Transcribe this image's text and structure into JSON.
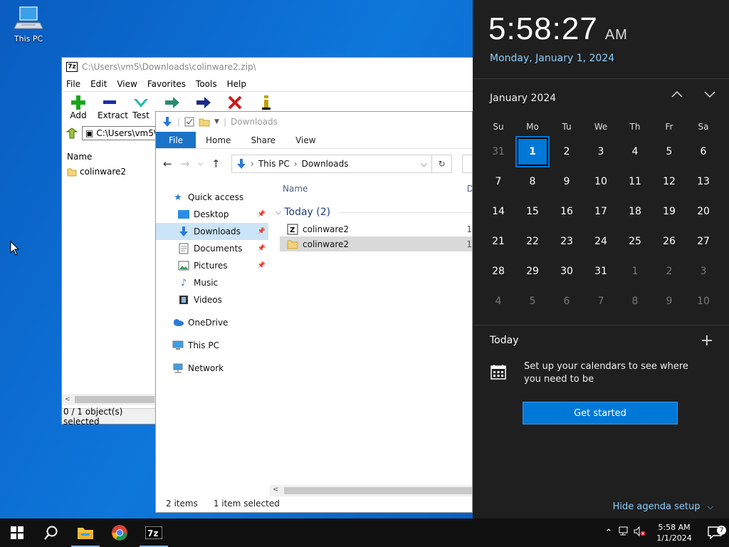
{
  "desktop": {
    "icon_label": "This PC"
  },
  "zip": {
    "title": "C:\\Users\\vm5\\Downloads\\colinware2.zip\\",
    "menu": [
      "File",
      "Edit",
      "View",
      "Favorites",
      "Tools",
      "Help"
    ],
    "tools": [
      {
        "label": "Add",
        "icon": "plus-icon",
        "color": "#1aa51a"
      },
      {
        "label": "Extract",
        "icon": "minus-icon",
        "color": "#1a2fa8"
      },
      {
        "label": "Test",
        "icon": "check-icon",
        "color": "#2bb5b0"
      },
      {
        "label": "",
        "icon": "copy-arrow-icon",
        "color": "#2a8a70"
      },
      {
        "label": "",
        "icon": "move-arrow-icon",
        "color": "#1a2a8a"
      },
      {
        "label": "",
        "icon": "delete-icon",
        "color": "#d01818"
      },
      {
        "label": "",
        "icon": "info-icon",
        "color": "#c0a000"
      }
    ],
    "address": "C:\\Users\\vm5\\",
    "column_name": "Name",
    "items": [
      "colinware2"
    ],
    "status": "0 / 1 object(s) selected"
  },
  "explorer": {
    "title": "Downloads",
    "ribbon": {
      "file": "File",
      "tabs": [
        "Home",
        "Share",
        "View"
      ]
    },
    "breadcrumb": [
      "This PC",
      "Downloads"
    ],
    "sidebar": [
      {
        "label": "Quick access",
        "icon": "star-icon",
        "level": 0,
        "pinned": false,
        "selected": false
      },
      {
        "label": "Desktop",
        "icon": "desktop-icon",
        "level": 1,
        "pinned": true,
        "selected": false
      },
      {
        "label": "Downloads",
        "icon": "download-icon",
        "level": 1,
        "pinned": true,
        "selected": true
      },
      {
        "label": "Documents",
        "icon": "documents-icon",
        "level": 1,
        "pinned": true,
        "selected": false
      },
      {
        "label": "Pictures",
        "icon": "pictures-icon",
        "level": 1,
        "pinned": true,
        "selected": false
      },
      {
        "label": "Music",
        "icon": "music-icon",
        "level": 1,
        "pinned": false,
        "selected": false
      },
      {
        "label": "Videos",
        "icon": "videos-icon",
        "level": 1,
        "pinned": false,
        "selected": false
      },
      {
        "label": "OneDrive",
        "icon": "cloud-icon",
        "level": 0,
        "pinned": false,
        "selected": false
      },
      {
        "label": "This PC",
        "icon": "computer-icon",
        "level": 0,
        "pinned": false,
        "selected": false
      },
      {
        "label": "Network",
        "icon": "network-icon",
        "level": 0,
        "pinned": false,
        "selected": false
      }
    ],
    "column_name": "Name",
    "column_date_stub": "D",
    "group_label": "Today (2)",
    "files": [
      {
        "name": "colinware2",
        "icon": "zip-file-icon",
        "date_stub": "1",
        "selected": false
      },
      {
        "name": "colinware2",
        "icon": "folder-icon",
        "date_stub": "1",
        "selected": true
      }
    ],
    "status_items": "2 items",
    "status_selected": "1 item selected"
  },
  "flyout": {
    "time": "5:58:27",
    "ampm": "AM",
    "date_long": "Monday, January 1, 2024",
    "month_label": "January 2024",
    "weekdays": [
      "Su",
      "Mo",
      "Tu",
      "We",
      "Th",
      "Fr",
      "Sa"
    ],
    "days": [
      {
        "d": "31",
        "dim": true
      },
      {
        "d": "1",
        "today": true
      },
      {
        "d": "2"
      },
      {
        "d": "3"
      },
      {
        "d": "4"
      },
      {
        "d": "5"
      },
      {
        "d": "6"
      },
      {
        "d": "7"
      },
      {
        "d": "8"
      },
      {
        "d": "9"
      },
      {
        "d": "10"
      },
      {
        "d": "11"
      },
      {
        "d": "12"
      },
      {
        "d": "13"
      },
      {
        "d": "14"
      },
      {
        "d": "15"
      },
      {
        "d": "16"
      },
      {
        "d": "17"
      },
      {
        "d": "18"
      },
      {
        "d": "19"
      },
      {
        "d": "20"
      },
      {
        "d": "21"
      },
      {
        "d": "22"
      },
      {
        "d": "23"
      },
      {
        "d": "24"
      },
      {
        "d": "25"
      },
      {
        "d": "26"
      },
      {
        "d": "27"
      },
      {
        "d": "28"
      },
      {
        "d": "29"
      },
      {
        "d": "30"
      },
      {
        "d": "31"
      },
      {
        "d": "1",
        "dim": true
      },
      {
        "d": "2",
        "dim": true
      },
      {
        "d": "3",
        "dim": true
      },
      {
        "d": "4",
        "dim": true
      },
      {
        "d": "5",
        "dim": true
      },
      {
        "d": "6",
        "dim": true
      },
      {
        "d": "7",
        "dim": true
      },
      {
        "d": "8",
        "dim": true
      },
      {
        "d": "9",
        "dim": true
      },
      {
        "d": "10",
        "dim": true
      }
    ],
    "today_label": "Today",
    "setup_text": "Set up your calendars to see where you need to be",
    "get_started": "Get started",
    "hide_agenda": "Hide agenda setup"
  },
  "taskbar": {
    "clock_time": "5:58 AM",
    "clock_date": "1/1/2024",
    "notification_count": "7"
  },
  "colors": {
    "accent": "#0078d7",
    "flyout_bg": "#1f1f1f",
    "link": "#8ecdf8"
  }
}
